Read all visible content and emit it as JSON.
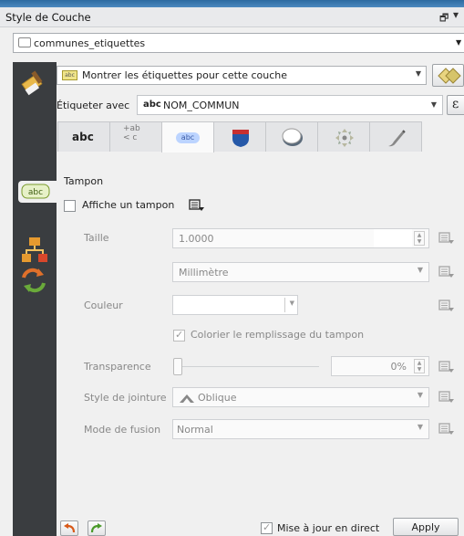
{
  "window": {
    "title": "Style de Couche",
    "float_glyph": "🗗",
    "close_glyph": "▾"
  },
  "layer": {
    "name": "communes_etiquettes"
  },
  "labels_mode": {
    "selected": "Montrer les étiquettes pour cette couche"
  },
  "label_with": {
    "caption": "Étiqueter avec",
    "prefix": "abc",
    "field": "NOM_COMMUN",
    "expr_glyph": "ε"
  },
  "tabs": [
    "abc",
    "+ab c",
    "abc",
    "shield",
    "bubble",
    "arrange",
    "brush"
  ],
  "section": {
    "title": "Tampon"
  },
  "draw_buffer": {
    "label": "Affiche un tampon",
    "checked": false
  },
  "size": {
    "label": "Taille",
    "value": "1.0000",
    "unit": "Millimètre"
  },
  "color": {
    "label": "Couleur",
    "fill_label": "Colorier le remplissage du tampon",
    "fill_checked": true
  },
  "transparency": {
    "label": "Transparence",
    "value": "0%"
  },
  "join_style": {
    "label": "Style de jointure",
    "value": "Oblique"
  },
  "blend_mode": {
    "label": "Mode de fusion",
    "value": "Normal"
  },
  "footer": {
    "live_update_label": "Mise à jour en direct",
    "live_update_checked": true,
    "apply_label": "Apply"
  },
  "colors": {
    "sidebar": "#3a3d40",
    "accent": "#2d6aa0"
  }
}
